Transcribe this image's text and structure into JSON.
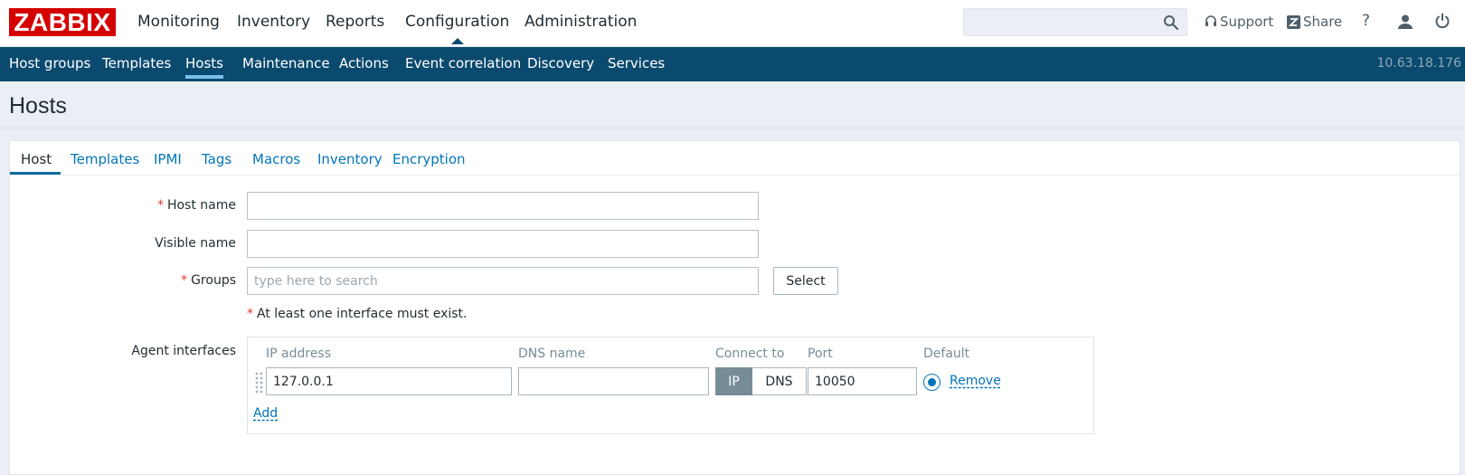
{
  "app": {
    "logo_text": "ZABBIX",
    "brand_color": "#d40000",
    "accent_color": "#0b4a6f"
  },
  "main_menu": [
    {
      "label": "Monitoring"
    },
    {
      "label": "Inventory"
    },
    {
      "label": "Reports"
    },
    {
      "label": "Configuration",
      "active": true
    },
    {
      "label": "Administration"
    }
  ],
  "search": {
    "value": "",
    "placeholder": "",
    "icon": "search-icon"
  },
  "top_links": {
    "support": {
      "label": "Support",
      "icon": "headset-icon"
    },
    "share": {
      "label": "Share",
      "icon": "zabbix-share-icon"
    },
    "help": {
      "label": "?",
      "icon": "help-icon"
    },
    "profile": {
      "icon": "user-icon"
    },
    "signout": {
      "icon": "power-icon"
    }
  },
  "sub_menu": [
    {
      "label": "Host groups"
    },
    {
      "label": "Templates"
    },
    {
      "label": "Hosts",
      "active": true
    },
    {
      "label": "Maintenance"
    },
    {
      "label": "Actions"
    },
    {
      "label": "Event correlation"
    },
    {
      "label": "Discovery"
    },
    {
      "label": "Services"
    }
  ],
  "server_ip": "10.63.18.176",
  "page": {
    "title": "Hosts"
  },
  "tabs": [
    {
      "label": "Host",
      "active": true
    },
    {
      "label": "Templates"
    },
    {
      "label": "IPMI"
    },
    {
      "label": "Tags"
    },
    {
      "label": "Macros"
    },
    {
      "label": "Inventory"
    },
    {
      "label": "Encryption"
    }
  ],
  "form": {
    "required_mark": "*",
    "host_name": {
      "label": "Host name",
      "value": ""
    },
    "visible_name": {
      "label": "Visible name",
      "value": ""
    },
    "groups": {
      "label": "Groups",
      "placeholder": "type here to search",
      "select_label": "Select"
    },
    "interface_note": "At least one interface must exist.",
    "agent_interfaces": {
      "label": "Agent interfaces",
      "columns": {
        "ip": "IP address",
        "dns": "DNS name",
        "connect": "Connect to",
        "port": "Port",
        "default": "Default"
      },
      "row": {
        "ip": "127.0.0.1",
        "dns": "",
        "connect_ip": "IP",
        "connect_dns": "DNS",
        "connect_selected": "IP",
        "port": "10050",
        "default_selected": true,
        "remove_label": "Remove"
      },
      "add_label": "Add"
    }
  }
}
